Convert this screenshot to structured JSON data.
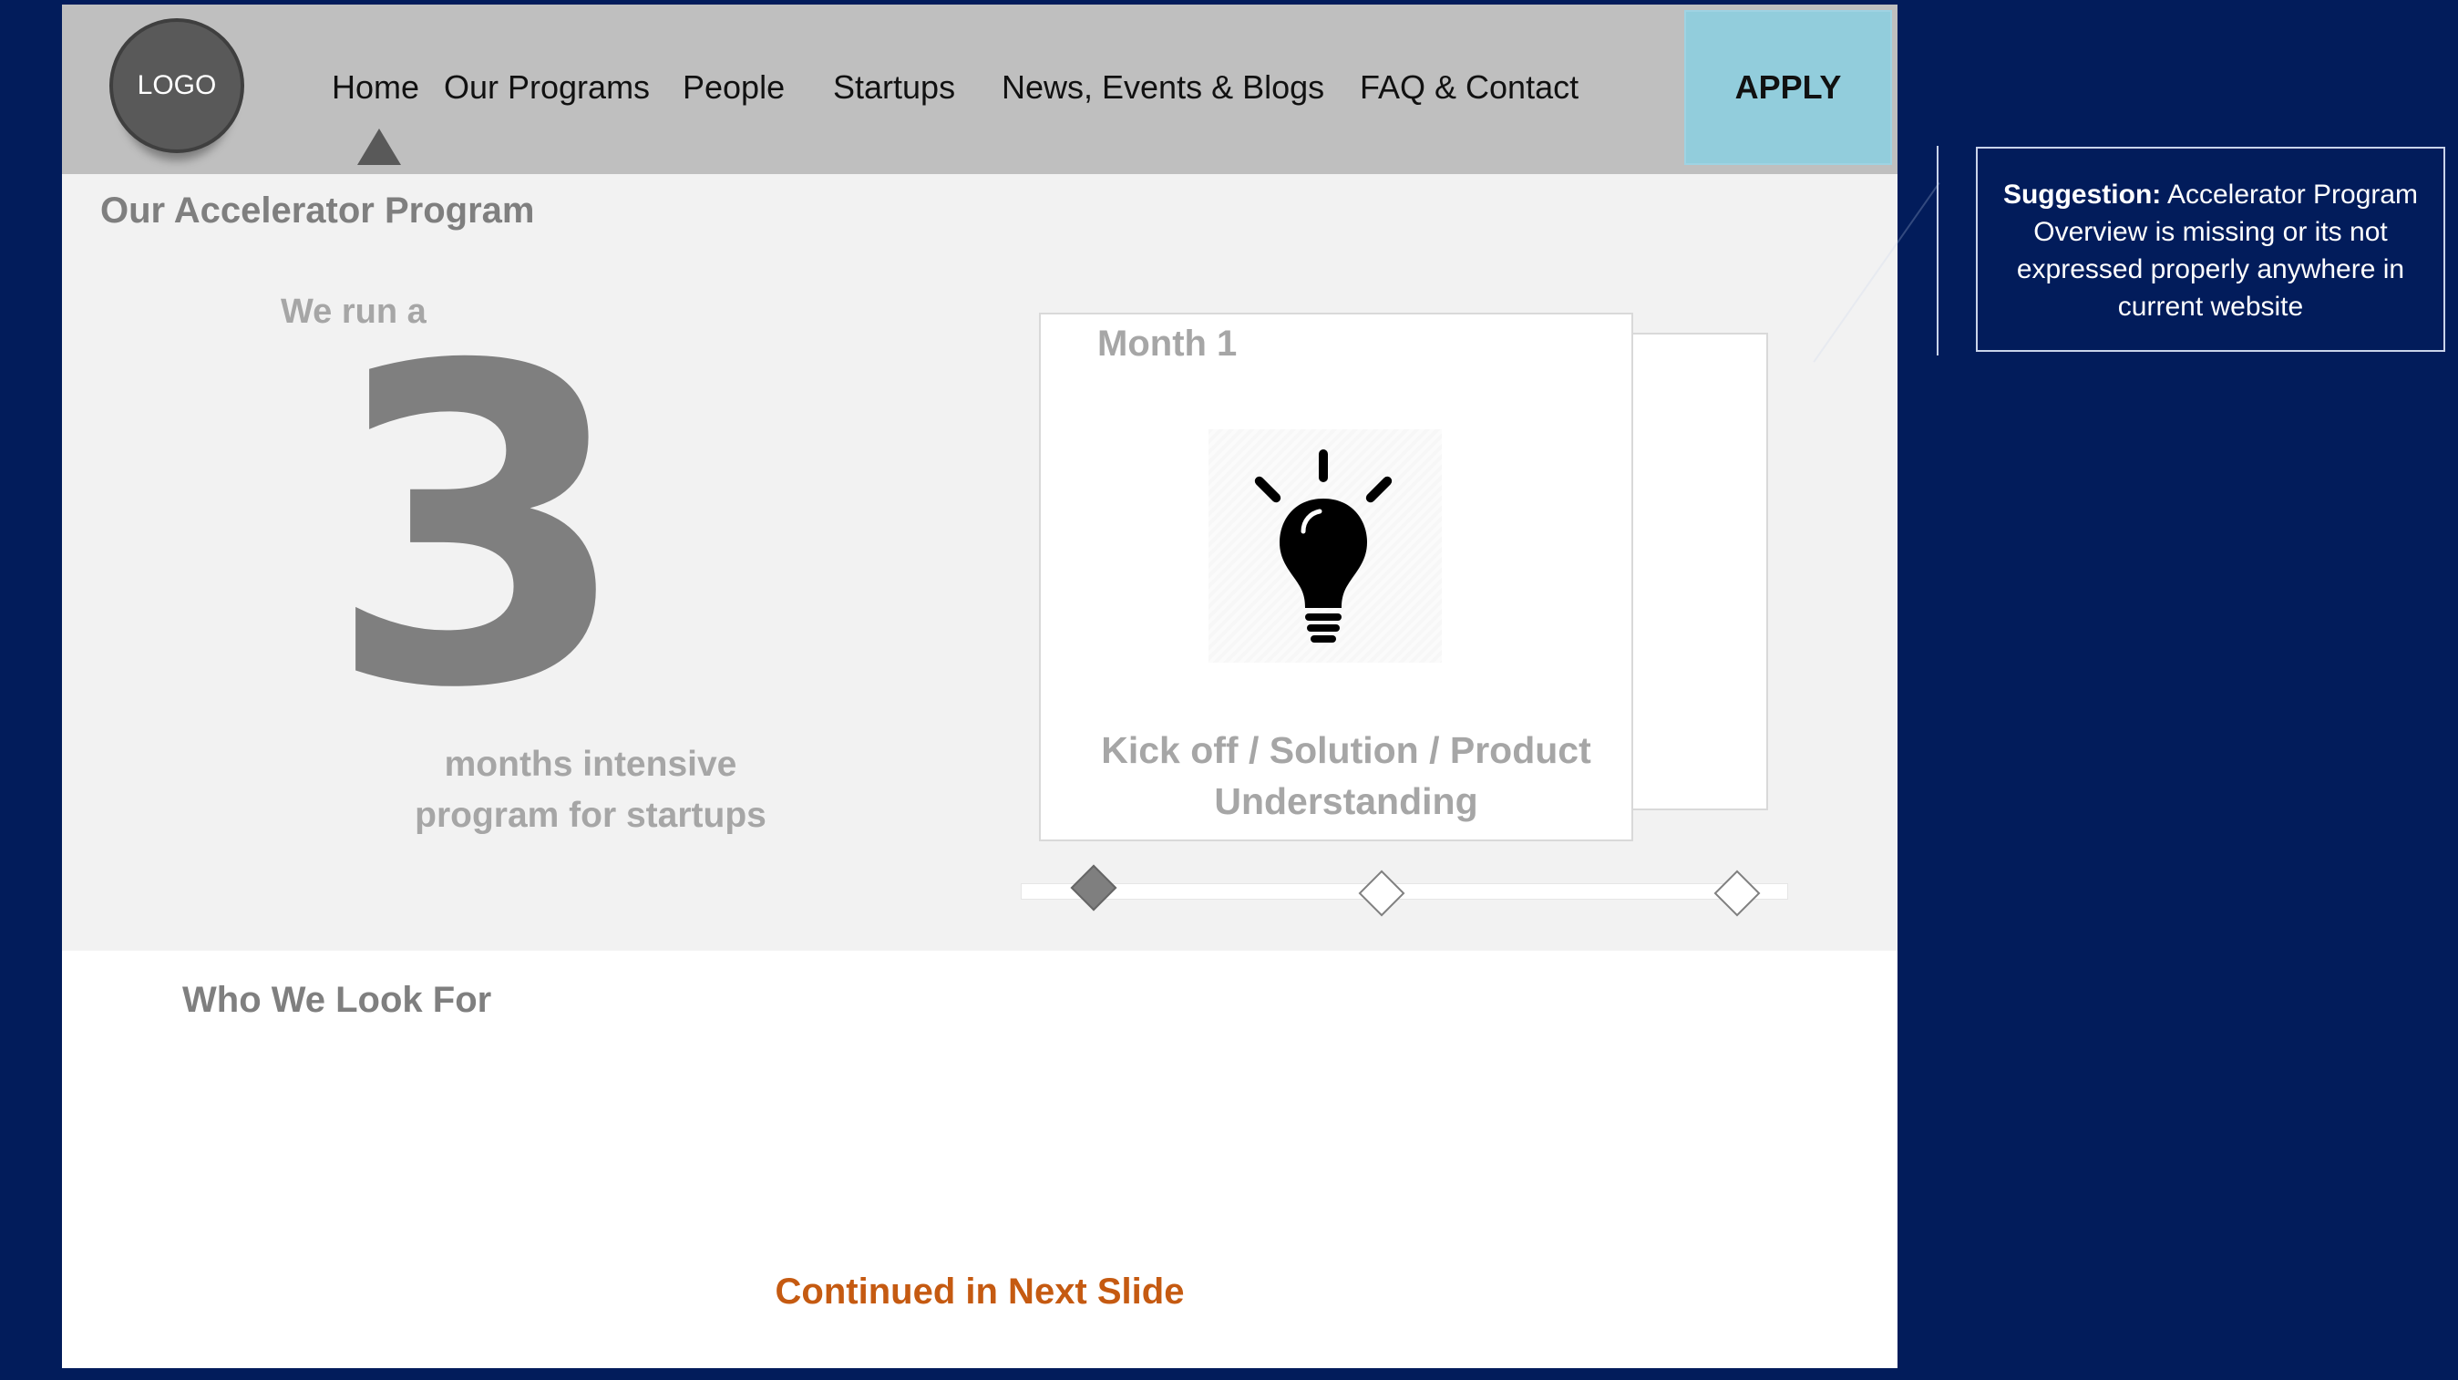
{
  "header": {
    "logo": "LOGO",
    "nav": [
      "Home",
      "Our Programs",
      "People",
      "Startups",
      "News, Events & Blogs",
      "FAQ & Contact"
    ],
    "active_nav": "Home",
    "apply_label": "APPLY"
  },
  "program": {
    "title": "Our Accelerator Program",
    "we_run": "We run a",
    "number": "3",
    "months_line1": "months intensive",
    "months_line2": "program for startups",
    "card": {
      "month": "Month 1",
      "icon": "lightbulb-icon",
      "caption_line1": "Kick off / Solution / Product",
      "caption_line2": "Understanding"
    },
    "timeline": {
      "steps": 3,
      "active_step": 1
    }
  },
  "who": {
    "title": "Who We Look For"
  },
  "footer": {
    "continued": "Continued in Next Slide"
  },
  "annotation": {
    "label": "Suggestion:",
    "text": "Accelerator Program  Overview is missing or its not expressed properly anywhere in current website"
  },
  "colors": {
    "background": "#021c5b",
    "header": "#bfbfbf",
    "apply": "#92cddc",
    "accent_orange": "#c55a11"
  }
}
